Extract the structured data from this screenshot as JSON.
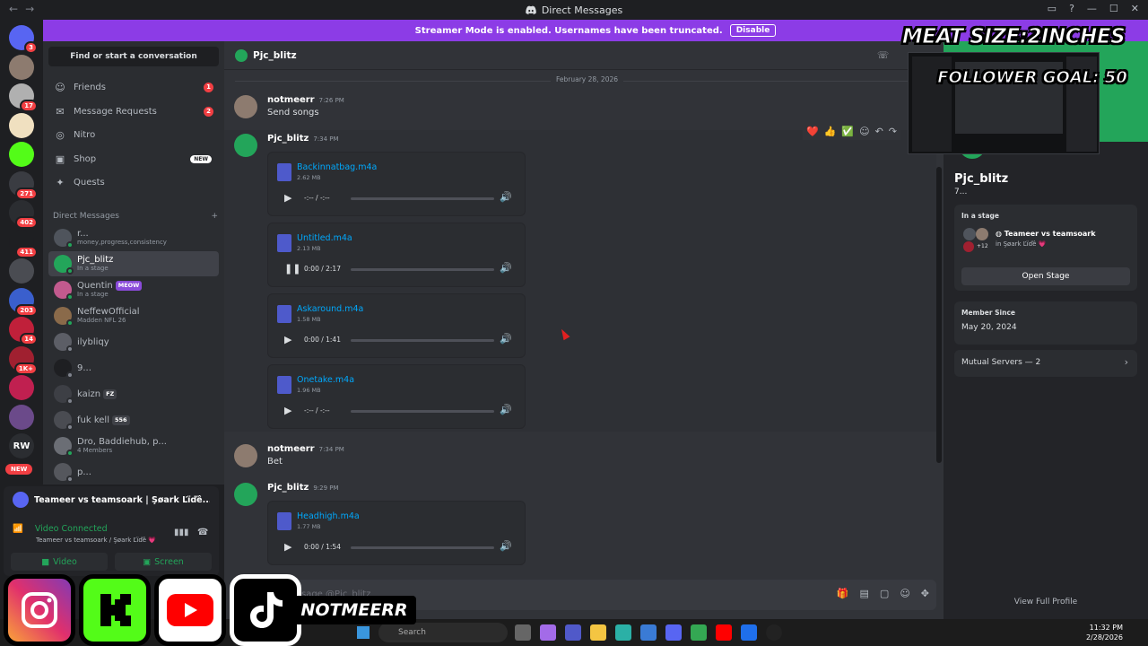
{
  "window": {
    "title": "Direct Messages",
    "back_glyph": "←",
    "fwd_glyph": "→"
  },
  "banner": {
    "text": "Streamer Mode is enabled. Usernames have been truncated.",
    "button": "Disable"
  },
  "servers": [
    {
      "badge": "3"
    },
    {
      "badge": ""
    },
    {
      "badge": "17"
    },
    {
      "badge": ""
    },
    {
      "badge": ""
    },
    {
      "badge": "271"
    },
    {
      "badge": "402"
    },
    {
      "badge": "411"
    },
    {
      "badge": ""
    },
    {
      "badge": "203"
    },
    {
      "badge": "14"
    },
    {
      "badge": "1K+"
    },
    {
      "badge": ""
    },
    {
      "badge": ""
    },
    {
      "text": "RW"
    }
  ],
  "servers_new": "NEW",
  "sidebar": {
    "search_placeholder": "Find or start a conversation",
    "nav": [
      {
        "label": "Friends",
        "count": "1"
      },
      {
        "label": "Message Requests",
        "count": "2"
      },
      {
        "label": "Nitro"
      },
      {
        "label": "Shop",
        "tag": "NEW"
      },
      {
        "label": "Quests"
      }
    ],
    "dm_header": "Direct Messages",
    "dm_add": "+",
    "dms": [
      {
        "name": "r...",
        "sub": "money,progress,consistency"
      },
      {
        "name": "Pjc_blitz",
        "sub": "In a stage"
      },
      {
        "name": "Quentin",
        "tag": "MEOW",
        "sub": "In a stage"
      },
      {
        "name": "NeffewOfficial",
        "sub": "Madden NFL 26"
      },
      {
        "name": "ilybliqy"
      },
      {
        "name": "9..."
      },
      {
        "name": "kaizn",
        "tag": "FZ"
      },
      {
        "name": "fuk kell",
        "tag": "556"
      },
      {
        "name": "Dro, Baddiehub, p...",
        "sub": "4 Members"
      },
      {
        "name": "p..."
      }
    ]
  },
  "voice": {
    "channel": "Teameer vs teamsoark | Şøark Ľïďê...",
    "status": "Video Connected",
    "sub": "Teameer vs teamsoark / Şøark Ľïďê 💗",
    "video": "Video",
    "screen": "Screen"
  },
  "chat": {
    "recipient": "Pjc_blitz",
    "date": "February 28, 2026",
    "messages": [
      {
        "author": "notmeerr",
        "time": "7:26 PM",
        "text": "Send songs"
      },
      {
        "author": "Pjc_blitz",
        "time": "7:34 PM"
      },
      {
        "author": "notmeerr",
        "time": "7:34 PM",
        "text": "Bet"
      },
      {
        "author": "Pjc_blitz",
        "time": "9:29 PM"
      }
    ],
    "attachments": [
      {
        "name": "Backinnatbag.m4a",
        "size": "2.62 MB",
        "time": "-:-- / -:--",
        "progress": 0.0,
        "playing": false
      },
      {
        "name": "Untitled.m4a",
        "size": "2.13 MB",
        "time": "0:00 / 2:17",
        "progress": 0.0,
        "playing": true
      },
      {
        "name": "Askaround.m4a",
        "size": "1.58 MB",
        "time": "0:00 / 1:41",
        "progress": 0.0,
        "playing": false
      },
      {
        "name": "Onetake.m4a",
        "size": "1.96 MB",
        "time": "-:-- / -:--",
        "progress": 0.0,
        "playing": false
      },
      {
        "name": "Headhigh.m4a",
        "size": "1.77 MB",
        "time": "0:00 / 1:54",
        "progress": 0.0,
        "playing": false
      }
    ],
    "reactions": [
      "❤️",
      "👍",
      "✅"
    ],
    "composer_placeholder": "Message @Pjc_blitz"
  },
  "profile": {
    "name": "Pjc_blitz",
    "display": "7...",
    "stage_label": "In a stage",
    "stage_name": "Teameer vs teamsoark",
    "stage_sub": "in Şøark Ľïďê 💗",
    "stage_extra": "+12",
    "open_stage": "Open Stage",
    "member_since_label": "Member Since",
    "member_since": "May 20, 2024",
    "mutual": "Mutual Servers — 2",
    "view_full": "View Full Profile"
  },
  "overlay": {
    "title": "MEAT SIZE:2INCHES",
    "goal": "FOLLOWER GOAL: 50",
    "handle": "NOTMEERR"
  },
  "taskbar": {
    "search": "Search",
    "time": "11:32 PM",
    "date": "2/28/2026"
  },
  "colors": {
    "accent": "#5865f2",
    "banner": "#8c3ce6",
    "green": "#23a55a",
    "red": "#f23f43"
  }
}
